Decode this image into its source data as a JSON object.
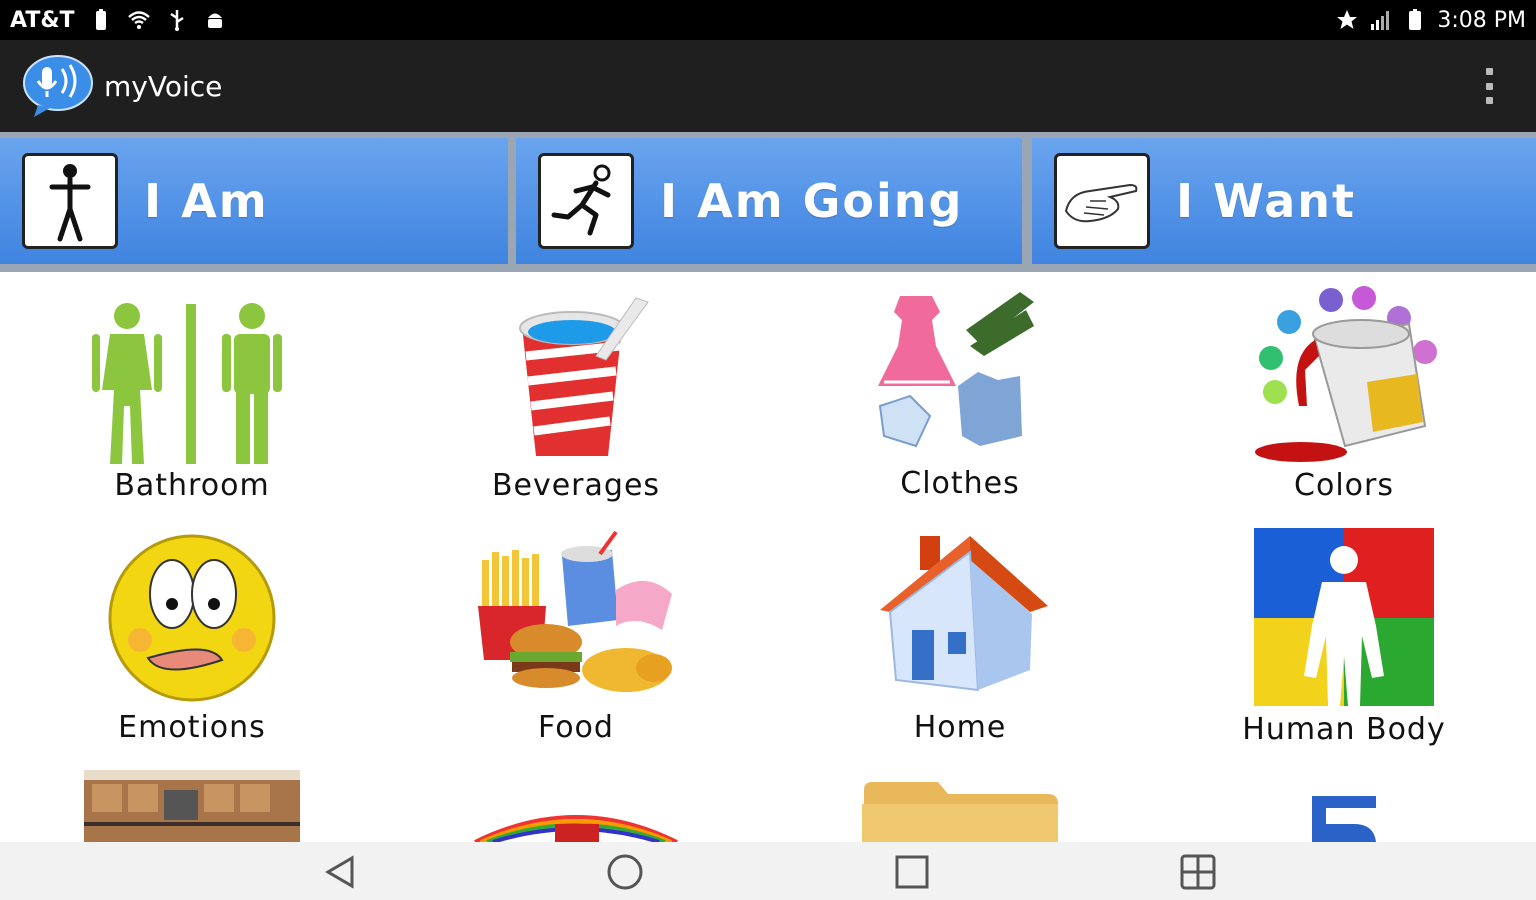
{
  "status_bar": {
    "carrier": "AT&T",
    "time": "3:08 PM",
    "icons_left": [
      "battery-icon",
      "wifi-icon",
      "usb-icon",
      "android-icon"
    ],
    "icons_right": [
      "star-icon",
      "signal-icon",
      "battery-icon"
    ]
  },
  "app_bar": {
    "title": "myVoice",
    "logo_icon": "speech-bubble-mic-icon",
    "menu_icon": "overflow-menu-icon"
  },
  "categories": [
    {
      "label": "I Am",
      "icon": "standing-person-icon"
    },
    {
      "label": "I Am Going",
      "icon": "running-person-icon"
    },
    {
      "label": "I Want",
      "icon": "open-hand-icon"
    }
  ],
  "tiles": [
    {
      "label": "Bathroom",
      "icon": "restroom-icon"
    },
    {
      "label": "Beverages",
      "icon": "drink-cup-icon"
    },
    {
      "label": "Clothes",
      "icon": "clothes-icon"
    },
    {
      "label": "Colors",
      "icon": "paint-bucket-icon"
    },
    {
      "label": "Emotions",
      "icon": "smiley-face-icon"
    },
    {
      "label": "Food",
      "icon": "fast-food-icon"
    },
    {
      "label": "Home",
      "icon": "house-icon"
    },
    {
      "label": "Human Body",
      "icon": "human-body-icon"
    }
  ],
  "partial_tiles": [
    "kitchen-photo-icon",
    "learn-rainbow-icon",
    "folder-icon",
    "number-five-icon"
  ],
  "nav_bar": [
    "back-icon",
    "home-circle-icon",
    "recents-square-icon",
    "multiwindow-icon"
  ],
  "colors": {
    "category_blue": "#4a8ee6",
    "appbar": "#1f1f1f",
    "statusbar": "#000000"
  }
}
